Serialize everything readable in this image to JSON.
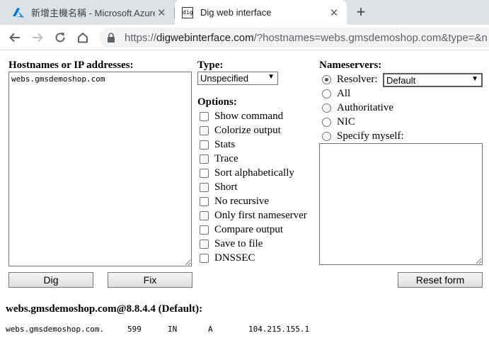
{
  "browser": {
    "tabs": [
      {
        "title": "新增主機名稱 - Microsoft Azure",
        "icon": "azure-icon",
        "active": false
      },
      {
        "title": "Dig web interface",
        "icon": "dig-favicon",
        "active": true
      }
    ],
    "favicon_text": "dig",
    "url_scheme": "https://",
    "url_host": "digwebinterface.com",
    "url_rest": "/?hostnames=webs.gmsdemoshop.com&type=&n"
  },
  "form": {
    "hostnames_label": "Hostnames or IP addresses:",
    "hostnames_value": "webs.gmsdemoshop.com",
    "type_label": "Type:",
    "type_value": "Unspecified",
    "options_label": "Options:",
    "options": [
      "Show command",
      "Colorize output",
      "Stats",
      "Trace",
      "Sort alphabetically",
      "Short",
      "No recursive",
      "Only first nameserver",
      "Compare output",
      "Save to file",
      "DNSSEC"
    ],
    "nameservers_label": "Nameservers:",
    "nameservers": [
      {
        "label": "Resolver:",
        "checked": true
      },
      {
        "label": "All",
        "checked": false
      },
      {
        "label": "Authoritative",
        "checked": false
      },
      {
        "label": "NIC",
        "checked": false
      },
      {
        "label": "Specify myself:",
        "checked": false
      }
    ],
    "resolver_value": "Default",
    "nameserver_text": "",
    "dig_button": "Dig",
    "fix_button": "Fix",
    "reset_button": "Reset form"
  },
  "result": {
    "heading": "webs.gmsdemoshop.com@8.8.4.4 (Default):",
    "record": {
      "name": "webs.gmsdemoshop.com.",
      "ttl": "599",
      "class": "IN",
      "type": "A",
      "value": "104.215.155.1"
    }
  }
}
